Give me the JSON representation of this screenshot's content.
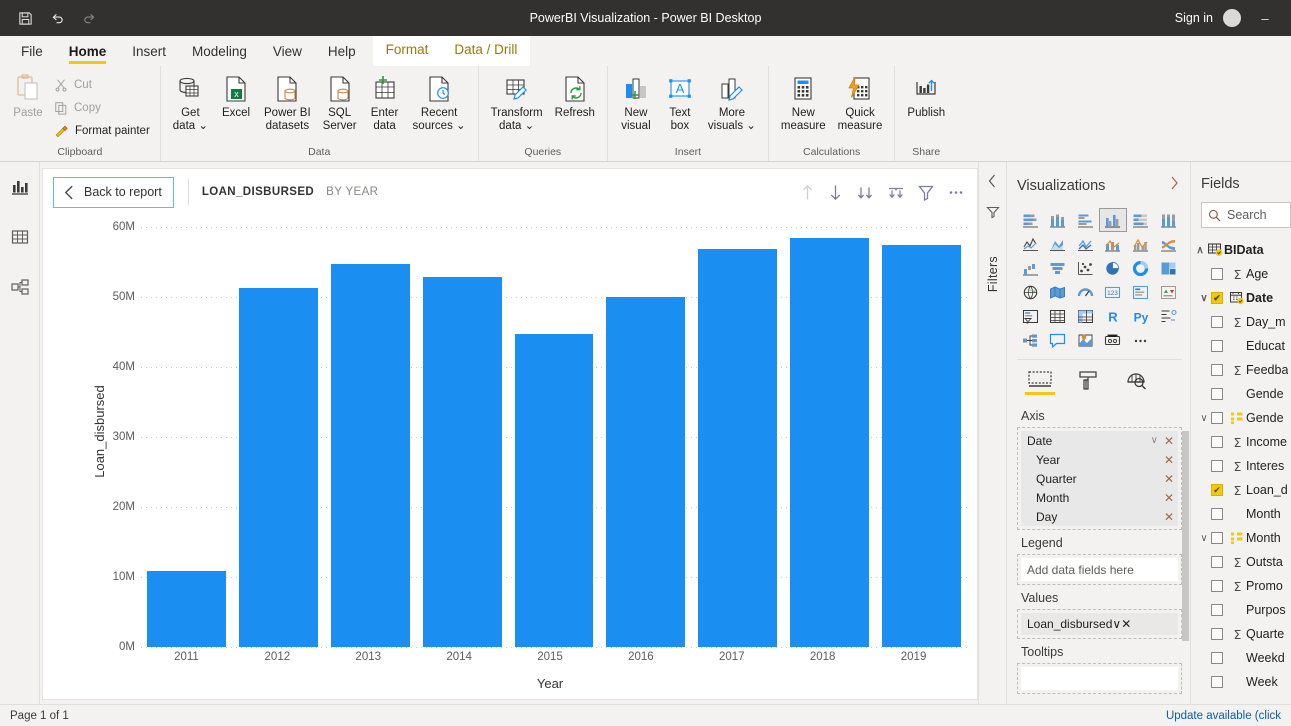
{
  "titlebar": {
    "title": "PowerBI Visualization - Power BI Desktop",
    "save_icon": "save-icon",
    "undo_icon": "undo-icon",
    "redo_icon": "redo-icon",
    "signin": "Sign in",
    "minimize": "–"
  },
  "ribbon": {
    "tabs": [
      {
        "label": "File",
        "active": false,
        "contextual": false
      },
      {
        "label": "Home",
        "active": true,
        "contextual": false
      },
      {
        "label": "Insert",
        "active": false,
        "contextual": false
      },
      {
        "label": "Modeling",
        "active": false,
        "contextual": false
      },
      {
        "label": "View",
        "active": false,
        "contextual": false
      },
      {
        "label": "Help",
        "active": false,
        "contextual": false
      },
      {
        "label": "Format",
        "active": false,
        "contextual": true
      },
      {
        "label": "Data / Drill",
        "active": false,
        "contextual": true
      }
    ],
    "groups": [
      {
        "name": "Clipboard",
        "label": "Clipboard",
        "paste": "Paste",
        "cut": "Cut",
        "copy": "Copy",
        "format_painter": "Format painter"
      },
      {
        "name": "Data",
        "label": "Data",
        "items": [
          {
            "label": "Get\ndata ⌄",
            "icon": "get-data-icon"
          },
          {
            "label": "Excel",
            "icon": "excel-icon"
          },
          {
            "label": "Power BI\ndatasets",
            "icon": "powerbi-datasets-icon"
          },
          {
            "label": "SQL\nServer",
            "icon": "sql-server-icon"
          },
          {
            "label": "Enter\ndata",
            "icon": "enter-data-icon"
          },
          {
            "label": "Recent\nsources ⌄",
            "icon": "recent-sources-icon"
          }
        ]
      },
      {
        "name": "Queries",
        "label": "Queries",
        "items": [
          {
            "label": "Transform\ndata ⌄",
            "icon": "transform-data-icon"
          },
          {
            "label": "Refresh",
            "icon": "refresh-icon"
          }
        ]
      },
      {
        "name": "Insert",
        "label": "Insert",
        "items": [
          {
            "label": "New\nvisual",
            "icon": "new-visual-icon"
          },
          {
            "label": "Text\nbox",
            "icon": "text-box-icon"
          },
          {
            "label": "More\nvisuals ⌄",
            "icon": "more-visuals-icon"
          }
        ]
      },
      {
        "name": "Calculations",
        "label": "Calculations",
        "items": [
          {
            "label": "New\nmeasure",
            "icon": "new-measure-icon"
          },
          {
            "label": "Quick\nmeasure",
            "icon": "quick-measure-icon"
          }
        ]
      },
      {
        "name": "Share",
        "label": "Share",
        "items": [
          {
            "label": "Publish",
            "icon": "publish-icon"
          }
        ]
      }
    ]
  },
  "rail": {
    "items": [
      {
        "name": "report-view",
        "icon": "report-chart-icon",
        "active": true
      },
      {
        "name": "data-view",
        "icon": "data-table-icon",
        "active": false
      },
      {
        "name": "model-view",
        "icon": "model-relationships-icon",
        "active": false
      }
    ]
  },
  "visual": {
    "back_label": "Back to report",
    "back_icon": "chevron-left-icon",
    "title": "LOAN_DISBURSED",
    "subtitle": "BY YEAR",
    "tools": [
      {
        "name": "drill-up-icon",
        "glyph": "↑",
        "dim": true
      },
      {
        "name": "drill-down-toggle-icon",
        "glyph": "↓",
        "dim": false
      },
      {
        "name": "go-to-next-level-icon",
        "glyph": "↓↓",
        "dim": false
      },
      {
        "name": "expand-all-down-icon",
        "glyph": "⤓",
        "dim": false
      },
      {
        "name": "filter-icon",
        "glyph": "∇",
        "dim": false
      },
      {
        "name": "more-options-icon",
        "glyph": "⋯",
        "dim": false
      }
    ]
  },
  "chart_data": {
    "type": "bar",
    "title": "LOAN_DISBURSED BY YEAR",
    "xlabel": "Year",
    "ylabel": "Loan_disbursed",
    "categories": [
      "2011",
      "2012",
      "2013",
      "2014",
      "2015",
      "2016",
      "2017",
      "2018",
      "2019"
    ],
    "values": [
      10.8,
      51.3,
      54.7,
      52.9,
      44.7,
      50.0,
      56.9,
      58.4,
      57.4
    ],
    "value_unit": "M",
    "ylim": [
      0,
      60
    ],
    "ytick_values": [
      0,
      10,
      20,
      30,
      40,
      50,
      60
    ],
    "ytick_labels": [
      "0M",
      "10M",
      "20M",
      "30M",
      "40M",
      "50M",
      "60M"
    ],
    "bar_color": "#1b8ef2",
    "grid": true,
    "legend": "none"
  },
  "filters_strip": {
    "collapse_icon": "chevron-left-icon",
    "label": "Filters",
    "icon": "filter-pane-icon"
  },
  "visualizations": {
    "title": "Visualizations",
    "expand_icon": "chevron-right-icon",
    "gallery": [
      {
        "name": "stacked-bar-chart-icon",
        "selected": false
      },
      {
        "name": "stacked-column-chart-icon",
        "selected": false
      },
      {
        "name": "clustered-bar-chart-icon",
        "selected": false
      },
      {
        "name": "clustered-column-chart-icon",
        "selected": true
      },
      {
        "name": "100-percent-stacked-bar-chart-icon",
        "selected": false
      },
      {
        "name": "100-percent-stacked-column-chart-icon",
        "selected": false
      },
      {
        "name": "line-chart-icon",
        "selected": false
      },
      {
        "name": "area-chart-icon",
        "selected": false
      },
      {
        "name": "stacked-area-chart-icon",
        "selected": false
      },
      {
        "name": "line-and-stacked-column-chart-icon",
        "selected": false
      },
      {
        "name": "line-and-clustered-column-chart-icon",
        "selected": false
      },
      {
        "name": "ribbon-chart-icon",
        "selected": false
      },
      {
        "name": "waterfall-chart-icon",
        "selected": false
      },
      {
        "name": "funnel-chart-icon",
        "selected": false
      },
      {
        "name": "scatter-chart-icon",
        "selected": false
      },
      {
        "name": "pie-chart-icon",
        "selected": false
      },
      {
        "name": "donut-chart-icon",
        "selected": false
      },
      {
        "name": "treemap-icon",
        "selected": false
      },
      {
        "name": "map-icon",
        "selected": false
      },
      {
        "name": "filled-map-icon",
        "selected": false
      },
      {
        "name": "gauge-icon",
        "selected": false
      },
      {
        "name": "card-icon",
        "selected": false
      },
      {
        "name": "multi-row-card-icon",
        "selected": false
      },
      {
        "name": "kpi-icon",
        "selected": false
      },
      {
        "name": "slicer-icon",
        "selected": false
      },
      {
        "name": "table-icon",
        "selected": false
      },
      {
        "name": "matrix-icon",
        "selected": false
      },
      {
        "name": "r-script-visual-icon",
        "selected": false,
        "text": "R"
      },
      {
        "name": "python-visual-icon",
        "selected": false,
        "text": "Py"
      },
      {
        "name": "key-influencers-icon",
        "selected": false
      },
      {
        "name": "decomposition-tree-icon",
        "selected": false
      },
      {
        "name": "qna-icon",
        "selected": false
      },
      {
        "name": "arcgis-maps-icon",
        "selected": false
      },
      {
        "name": "paginated-report-icon",
        "selected": false
      },
      {
        "name": "get-more-visuals-icon",
        "selected": false,
        "text": "⋯"
      }
    ],
    "tabs": [
      {
        "name": "fields-tab",
        "icon": "fields-well-icon",
        "active": true
      },
      {
        "name": "format-tab",
        "icon": "paint-roller-icon",
        "active": false
      },
      {
        "name": "analytics-tab",
        "icon": "analytics-magnifier-icon",
        "active": false
      }
    ],
    "wells": {
      "axis": {
        "label": "Axis",
        "items": [
          {
            "name": "Date",
            "child": false,
            "has_chevron": true,
            "has_close": true
          },
          {
            "name": "Year",
            "child": true,
            "has_chevron": false,
            "has_close": true
          },
          {
            "name": "Quarter",
            "child": true,
            "has_chevron": false,
            "has_close": true
          },
          {
            "name": "Month",
            "child": true,
            "has_chevron": false,
            "has_close": true
          },
          {
            "name": "Day",
            "child": true,
            "has_chevron": false,
            "has_close": true
          }
        ]
      },
      "legend": {
        "label": "Legend",
        "placeholder": "Add data fields here"
      },
      "values": {
        "label": "Values",
        "items": [
          {
            "name": "Loan_disbursed",
            "has_chevron": true,
            "has_close": true
          }
        ]
      },
      "tooltips": {
        "label": "Tooltips"
      }
    }
  },
  "fields": {
    "title": "Fields",
    "search_placeholder": "Search",
    "search_icon": "search-icon",
    "table": {
      "name": "BIData",
      "icon": "table-checked-icon",
      "expanded": true
    },
    "items": [
      {
        "label": "Age",
        "type": "sigma",
        "checked": false,
        "expandable": false,
        "expanded": false
      },
      {
        "label": "Date",
        "type": "calendar",
        "checked": true,
        "expandable": true,
        "expanded": true,
        "bold": true
      },
      {
        "label": "Day_m",
        "type": "sigma",
        "checked": false,
        "expandable": false,
        "child": true
      },
      {
        "label": "Educat",
        "type": "none",
        "checked": false,
        "expandable": false,
        "child": true
      },
      {
        "label": "Feedba",
        "type": "sigma",
        "checked": false,
        "expandable": false,
        "child": true
      },
      {
        "label": "Gende",
        "type": "none",
        "checked": false,
        "expandable": false,
        "child": true
      },
      {
        "label": "Gende",
        "type": "hierarchy",
        "checked": false,
        "expandable": true,
        "expanded": true
      },
      {
        "label": "Income",
        "type": "sigma",
        "checked": false,
        "expandable": false,
        "child": true
      },
      {
        "label": "Interes",
        "type": "sigma",
        "checked": false,
        "expandable": false,
        "child": true
      },
      {
        "label": "Loan_d",
        "type": "sigma",
        "checked": true,
        "expandable": false,
        "child": true
      },
      {
        "label": "Month",
        "type": "none",
        "checked": false,
        "expandable": false,
        "child": true
      },
      {
        "label": "Month",
        "type": "hierarchy",
        "checked": false,
        "expandable": true,
        "expanded": true
      },
      {
        "label": "Outsta",
        "type": "sigma",
        "checked": false,
        "expandable": false,
        "child": true
      },
      {
        "label": "Promo",
        "type": "sigma",
        "checked": false,
        "expandable": false,
        "child": true
      },
      {
        "label": "Purpos",
        "type": "none",
        "checked": false,
        "expandable": false,
        "child": true
      },
      {
        "label": "Quarte",
        "type": "sigma",
        "checked": false,
        "expandable": false,
        "child": true
      },
      {
        "label": "Weekd",
        "type": "none",
        "checked": false,
        "expandable": false,
        "child": true
      },
      {
        "label": "Week",
        "type": "none",
        "checked": false,
        "expandable": false,
        "child": true
      }
    ]
  },
  "statusbar": {
    "page": "Page 1 of 1",
    "update": "Update available (click"
  },
  "colors": {
    "accent_yellow": "#f2c811",
    "bar_blue": "#1b8ef2",
    "titlebar_bg": "#323130",
    "ribbon_bg": "#f3f2f1",
    "contextual_tab": "#9a7a09"
  }
}
